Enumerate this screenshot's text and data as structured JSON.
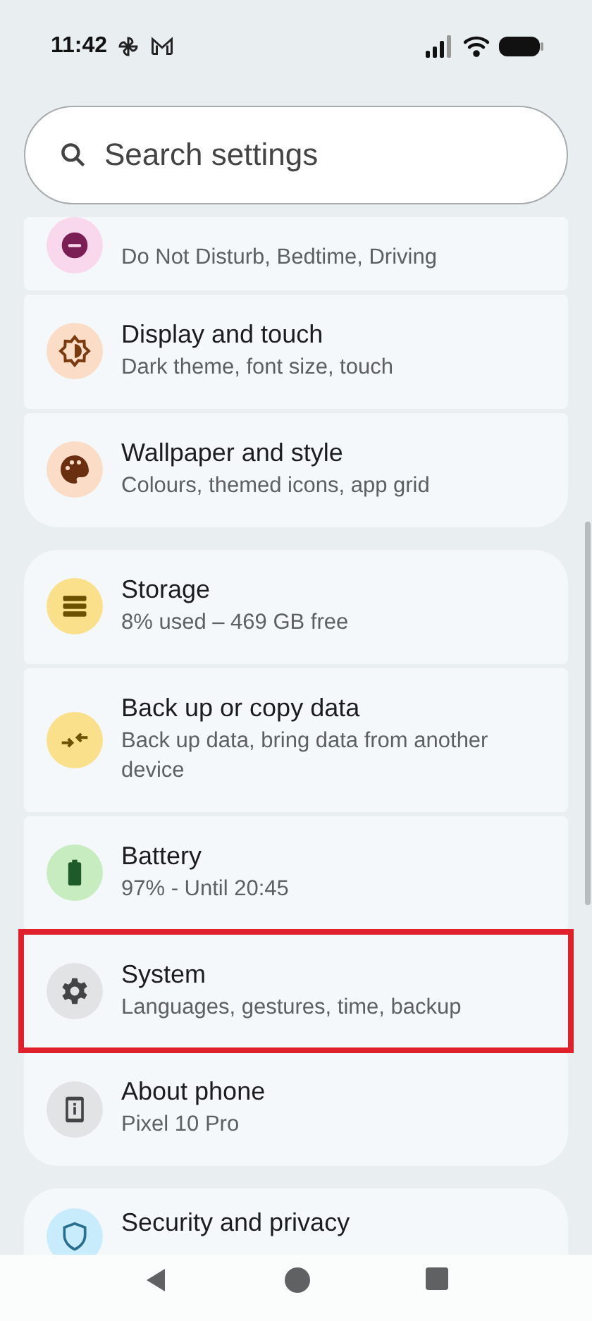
{
  "status_bar": {
    "time": "11:42"
  },
  "search": {
    "placeholder": "Search settings"
  },
  "groups": [
    {
      "items": [
        {
          "kind": "modes",
          "color": "#f9d8ee",
          "subtitle": "Do Not Disturb, Bedtime, Driving",
          "highlighted": false
        },
        {
          "kind": "display",
          "color": "#fbdcc6",
          "title": "Display and touch",
          "subtitle": "Dark theme, font size, touch",
          "highlighted": false
        },
        {
          "kind": "palette",
          "color": "#fbdcc6",
          "title": "Wallpaper and style",
          "subtitle": "Colours, themed icons, app grid",
          "highlighted": false
        }
      ]
    },
    {
      "items": [
        {
          "kind": "storage",
          "color": "#fbe08c",
          "title": "Storage",
          "subtitle": "8% used – 469 GB free",
          "highlighted": false
        },
        {
          "kind": "backup",
          "color": "#fbe08c",
          "title": "Back up or copy data",
          "subtitle": "Back up data, bring data from another device",
          "highlighted": false
        },
        {
          "kind": "battery",
          "color": "#c6ecc0",
          "title": "Battery",
          "subtitle": "97% - Until 20:45",
          "highlighted": false
        },
        {
          "kind": "gear",
          "color": "#e2e3e5",
          "title": "System",
          "subtitle": "Languages, gestures, time, backup",
          "highlighted": true
        },
        {
          "kind": "info",
          "color": "#e2e3e5",
          "title": "About phone",
          "subtitle": "Pixel 10 Pro",
          "highlighted": false
        }
      ]
    },
    {
      "items": [
        {
          "kind": "shield",
          "color": "#c8ecfb",
          "title": "Security and privacy",
          "highlighted": false
        }
      ]
    }
  ]
}
